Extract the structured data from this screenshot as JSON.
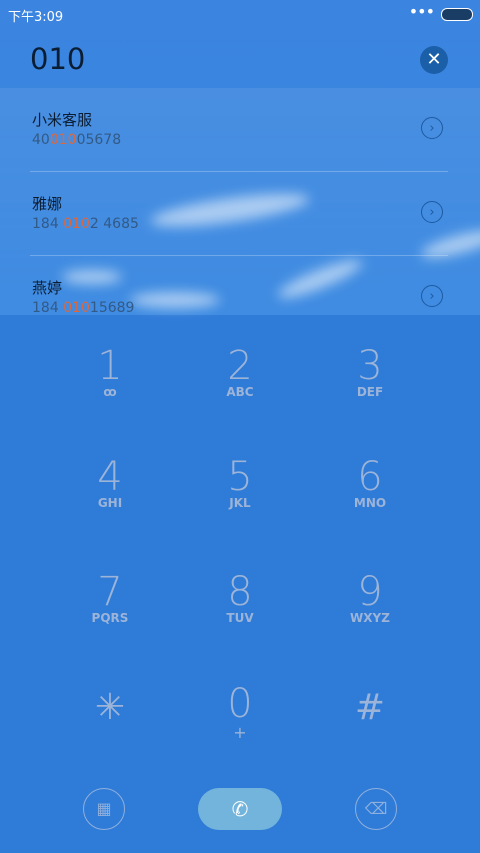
{
  "status_bar": {
    "time": "下午3:09",
    "more": "•••"
  },
  "dial_input": {
    "value": "010"
  },
  "results": [
    {
      "name": "小米客服",
      "number_prefix": "40",
      "number_match": "010",
      "number_suffix": "05678"
    },
    {
      "name": "雅娜",
      "number_prefix": "184 ",
      "number_match": "010",
      "number_suffix": "2 4685"
    },
    {
      "name": "燕婷",
      "number_prefix": "184 ",
      "number_match": "010",
      "number_suffix": "15689"
    }
  ],
  "keypad": [
    {
      "digit": "1",
      "letters": ""
    },
    {
      "digit": "2",
      "letters": "ABC"
    },
    {
      "digit": "3",
      "letters": "DEF"
    },
    {
      "digit": "4",
      "letters": "GHI"
    },
    {
      "digit": "5",
      "letters": "JKL"
    },
    {
      "digit": "6",
      "letters": "MNO"
    },
    {
      "digit": "7",
      "letters": "PQRS"
    },
    {
      "digit": "8",
      "letters": "TUV"
    },
    {
      "digit": "9",
      "letters": "WXYZ"
    },
    {
      "digit": "*",
      "letters": ""
    },
    {
      "digit": "0",
      "letters": "+"
    },
    {
      "digit": "#",
      "letters": ""
    }
  ],
  "icons": {
    "voicemail": "voicemail-icon",
    "clear": "clear-icon",
    "arrow": "chevron-right-icon",
    "keypad": "grid-icon",
    "call": "phone-icon",
    "backspace": "backspace-icon"
  },
  "colors": {
    "highlight": "#e0673a",
    "background": "#2f7bd8",
    "call": "#73b4dd"
  }
}
